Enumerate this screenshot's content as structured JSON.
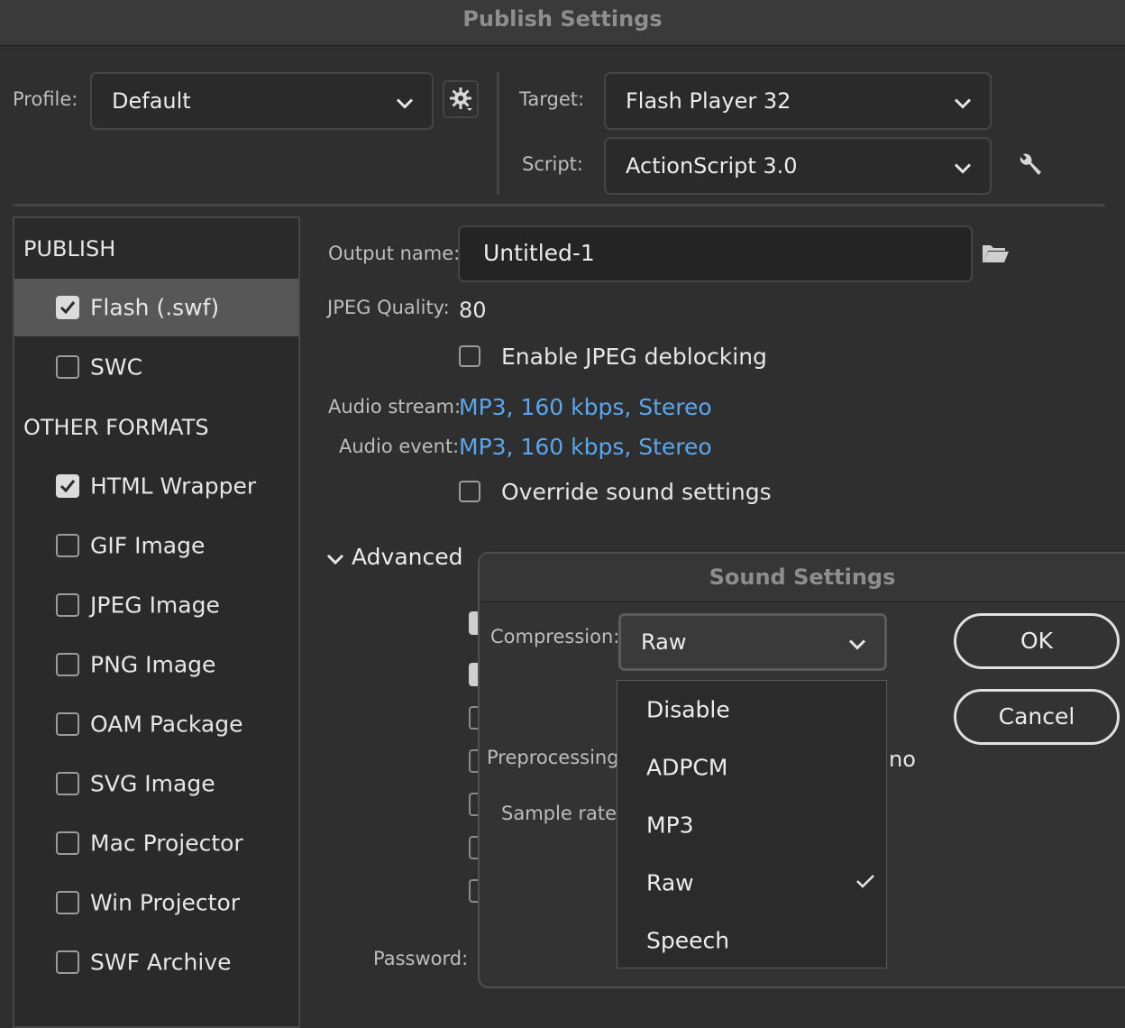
{
  "window": {
    "title": "Publish Settings"
  },
  "profile": {
    "label": "Profile:",
    "value": "Default"
  },
  "target": {
    "label": "Target:",
    "value": "Flash Player 32"
  },
  "script": {
    "label": "Script:",
    "value": "ActionScript 3.0"
  },
  "left": {
    "publish_header": "PUBLISH",
    "publish_items": [
      {
        "label": "Flash (.swf)",
        "checked": true,
        "selected": true
      },
      {
        "label": "SWC",
        "checked": false
      }
    ],
    "other_header": "OTHER FORMATS",
    "other_items": [
      {
        "label": "HTML Wrapper",
        "checked": true
      },
      {
        "label": "GIF Image",
        "checked": false
      },
      {
        "label": "JPEG Image",
        "checked": false
      },
      {
        "label": "PNG Image",
        "checked": false
      },
      {
        "label": "OAM Package",
        "checked": false
      },
      {
        "label": "SVG Image",
        "checked": false
      },
      {
        "label": "Mac Projector",
        "checked": false
      },
      {
        "label": "Win Projector",
        "checked": false
      },
      {
        "label": "SWF Archive",
        "checked": false
      }
    ]
  },
  "main": {
    "output_name_label": "Output name:",
    "output_name_value": "Untitled-1",
    "jpeg_quality_label": "JPEG Quality:",
    "jpeg_quality_value": "80",
    "jpeg_deblocking_label": "Enable JPEG deblocking",
    "audio_stream_label": "Audio stream:",
    "audio_stream_value": "MP3, 160 kbps, Stereo",
    "audio_event_label": "Audio event:",
    "audio_event_value": "MP3, 160 kbps, Stereo",
    "override_sound_label": "Override sound settings",
    "advanced_label": "Advanced",
    "password_label": "Password:"
  },
  "sound_dialog": {
    "title": "Sound Settings",
    "compression_label": "Compression:",
    "compression_value": "Raw",
    "preprocessing_label": "Preprocessing:",
    "preprocessing_partial": "no",
    "sample_rate_label": "Sample rate:",
    "ok_label": "OK",
    "cancel_label": "Cancel",
    "options": [
      {
        "label": "Disable",
        "checked": false
      },
      {
        "label": "ADPCM",
        "checked": false
      },
      {
        "label": "MP3",
        "checked": false
      },
      {
        "label": "Raw",
        "checked": true
      },
      {
        "label": "Speech",
        "checked": false
      }
    ]
  },
  "colors": {
    "accent_link": "#5aa7ee",
    "background": "#2f2f2f",
    "selected_row": "#575757"
  }
}
